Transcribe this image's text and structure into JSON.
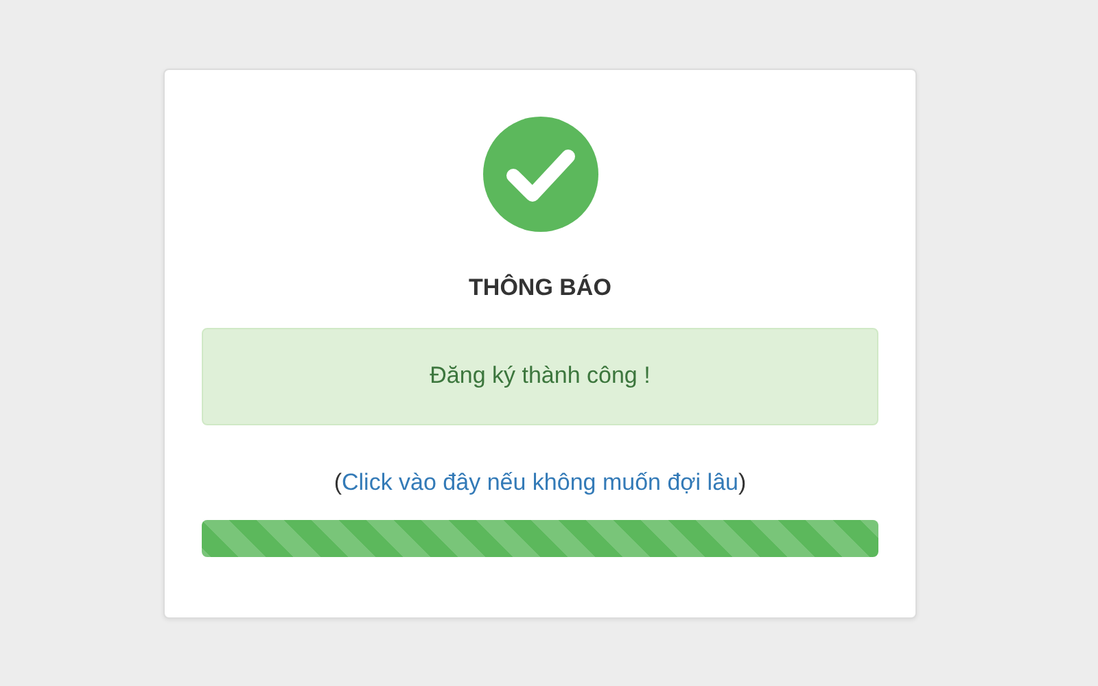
{
  "dialog": {
    "title": "THÔNG BÁO",
    "message": "Đăng ký thành công !",
    "link_prefix": "(",
    "link": "Click vào đây nếu không muốn đợi lâu",
    "link_suffix": ")",
    "progress": {
      "level": 1
    }
  }
}
